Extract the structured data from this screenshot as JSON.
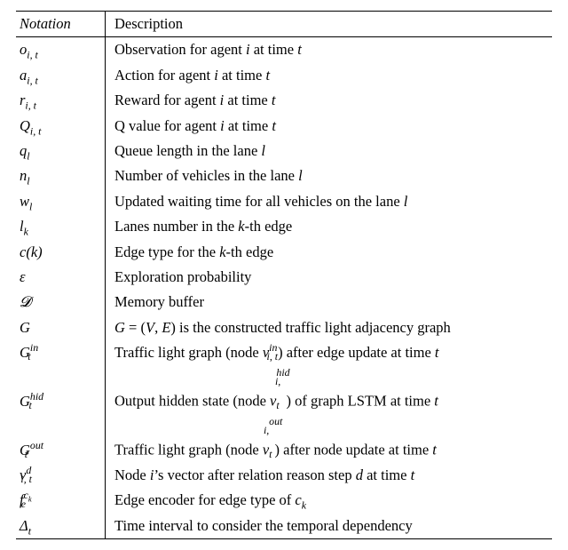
{
  "table": {
    "header": {
      "notation": "Notation",
      "description": "Description"
    },
    "rows": [
      {
        "notation_html": "<span class='mi'>o</span><sub><span class='mi'>i</span>, <span class='mi'>t</span></sub>",
        "description_html": "Observation for agent <span class='mi'>i</span> at time <span class='mi'>t</span>"
      },
      {
        "notation_html": "<span class='mi'>a</span><sub><span class='mi'>i</span>, <span class='mi'>t</span></sub>",
        "description_html": "Action for agent <span class='mi'>i</span> at time <span class='mi'>t</span>"
      },
      {
        "notation_html": "<span class='mi'>r</span><sub><span class='mi'>i</span>, <span class='mi'>t</span></sub>",
        "description_html": "Reward for agent <span class='mi'>i</span> at time <span class='mi'>t</span>"
      },
      {
        "notation_html": "<span class='mi'>Q</span><sub><span class='mi'>i</span>, <span class='mi'>t</span></sub>",
        "description_html": "Q value for agent <span class='mi'>i</span> at time <span class='mi'>t</span>"
      },
      {
        "notation_html": "<span class='mi'>q</span><sub><span class='mi'>l</span></sub>",
        "description_html": "Queue length in the lane <span class='mi'>l</span>"
      },
      {
        "notation_html": "<span class='mi'>n</span><sub><span class='mi'>l</span></sub>",
        "description_html": "Number of vehicles in the lane <span class='mi'>l</span>"
      },
      {
        "notation_html": "<span class='mi'>w</span><sub><span class='mi'>l</span></sub>",
        "description_html": "Updated waiting time for all vehicles on the lane <span class='mi'>l</span>"
      },
      {
        "notation_html": "<span class='mi'>l</span><sub><span class='mi'>k</span></sub>",
        "description_html": "Lanes number in the <span class='mi'>k</span>-th edge"
      },
      {
        "notation_html": "<span class='mi'>c</span>(<span class='mi'>k</span>)",
        "description_html": "Edge type for the <span class='mi'>k</span>-th edge"
      },
      {
        "notation_html": "<span class='mi'>&epsilon;</span>",
        "description_html": "Exploration probability"
      },
      {
        "notation_html": "<span class='cal'>&#x1D4D3;</span>",
        "description_html": "Memory buffer"
      },
      {
        "notation_html": "<span class='mi'>G</span>",
        "description_html": "<span class='mi'>G</span> = (<span class='mi'>V</span>, <span class='mi'>E</span>) is the constructed traffic light adjacency graph"
      },
      {
        "notation_html": "<span class='mi'>G</span><span class='ss'><span class='sup'><span class='mi'>in</span></span><span class='sub'><span class='mi'>t</span></span></span>",
        "description_html": "Traffic light graph (node <span class='mi'>v</span><span class='ss'><span class='sup'><span class='mi'>in</span></span><span class='sub'><span class='mi'>i</span>, <span class='mi'>t</span></span></span>) after edge update at time <span class='mi'>t</span>"
      },
      {
        "notation_html": "<span class='mi'>G</span><span class='ss'><span class='sup'><span class='mi'>hid</span></span><span class='sub wide'><span class='mi'>t</span></span></span>",
        "description_html": "Output hidden state (node <span class='mi'>v</span><span class='ss'><span class='sup'><span class='mi'>hid</span></span><span class='sub wide'><span class='mi'>i</span>, <span class='mi'>t</span></span></span>) of graph LSTM at time <span class='mi'>t</span>"
      },
      {
        "notation_html": "<span class='mi'>G</span><span class='ss'><span class='sup'><span class='mi'>out</span></span><span class='sub w3'><span class='mi'>t</span></span></span>",
        "description_html": "Traffic light graph (node <span class='mi'>v</span><span class='ss'><span class='sup'><span class='mi'>out</span></span><span class='sub w3'><span class='mi'>i</span>, <span class='mi'>t</span></span></span>) after node update at time <span class='mi'>t</span>"
      },
      {
        "notation_html": "<span class='mi'>v</span><span class='ss'><span class='sup'><span class='mi'>d</span></span><span class='sub'><span class='mi'>i</span>, <span class='mi'>t</span></span></span>",
        "description_html": "Node <span class='mi'>i</span>&rsquo;s vector after relation reason step <span class='mi'>d</span> at time <span class='mi'>t</span>"
      },
      {
        "notation_html": "<span class='mi'>f</span><span class='ss'><span class='sup'><span class='mi'>c<sub>k</sub></span></span><span class='sub'><span class='mi'>e</span></span></span>",
        "description_html": "Edge encoder for edge type of <span class='mi'>c</span><sub><span class='mi'>k</span></sub>"
      },
      {
        "notation_html": "&Delta;<sub><span class='mi'>t</span></sub>",
        "description_html": "Time interval to consider the temporal dependency"
      }
    ]
  }
}
